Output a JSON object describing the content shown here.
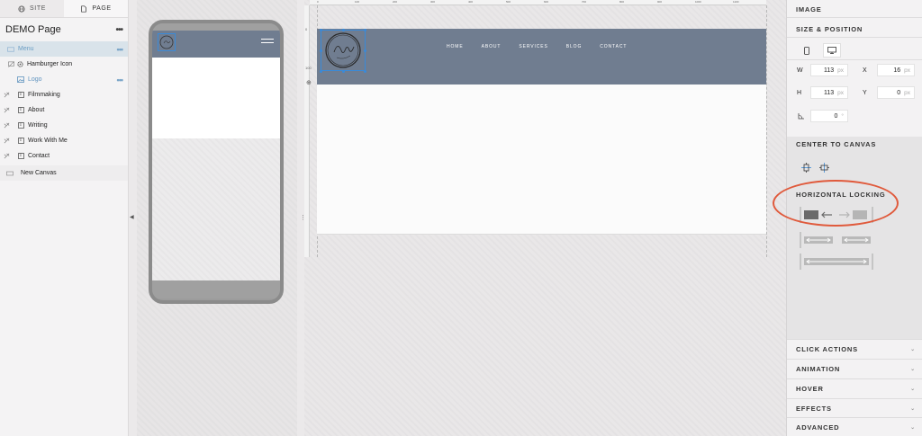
{
  "left_panel": {
    "tabs": [
      {
        "label": "SITE",
        "icon": "globe-icon"
      },
      {
        "label": "PAGE",
        "icon": "page-icon"
      }
    ],
    "page_title": "DEMO Page",
    "more": "•••",
    "layers": [
      {
        "label": "Menu",
        "selected": true,
        "more": "•••"
      },
      {
        "label": "Hamburger Icon"
      },
      {
        "label": "Logo",
        "more": "•••"
      },
      {
        "label": "Filmmaking"
      },
      {
        "label": "About"
      },
      {
        "label": "Writing"
      },
      {
        "label": "Work With Me"
      },
      {
        "label": "Contact"
      }
    ],
    "new_canvas": "New Canvas"
  },
  "canvas": {
    "nav_items": [
      "HOME",
      "ABOUT",
      "SERVICES",
      "BLOG",
      "CONTACT"
    ],
    "ruler_marks": [
      "0",
      "100",
      "200",
      "300",
      "400",
      "500",
      "600",
      "700",
      "800",
      "900",
      "1000",
      "1100"
    ],
    "side_marks": [
      "0",
      "100"
    ],
    "header_color": "#707d90",
    "selection_color": "#3a8ad8"
  },
  "right_panel": {
    "image_header": "IMAGE",
    "size_position_header": "SIZE & POSITION",
    "fields": {
      "w_label": "W",
      "w_value": "113",
      "w_unit": "px",
      "x_label": "X",
      "x_value": "16",
      "x_unit": "px",
      "h_label": "H",
      "h_value": "113",
      "h_unit": "px",
      "y_label": "Y",
      "y_value": "0",
      "y_unit": "px",
      "rotation_value": "0",
      "rotation_unit": "°"
    },
    "center_to_canvas": "CENTER TO CANVAS",
    "horizontal_locking": "HORIZONTAL LOCKING",
    "accordions": [
      "CLICK ACTIONS",
      "ANIMATION",
      "HOVER",
      "EFFECTS",
      "ADVANCED"
    ],
    "highlight_color": "#e05a3c"
  }
}
